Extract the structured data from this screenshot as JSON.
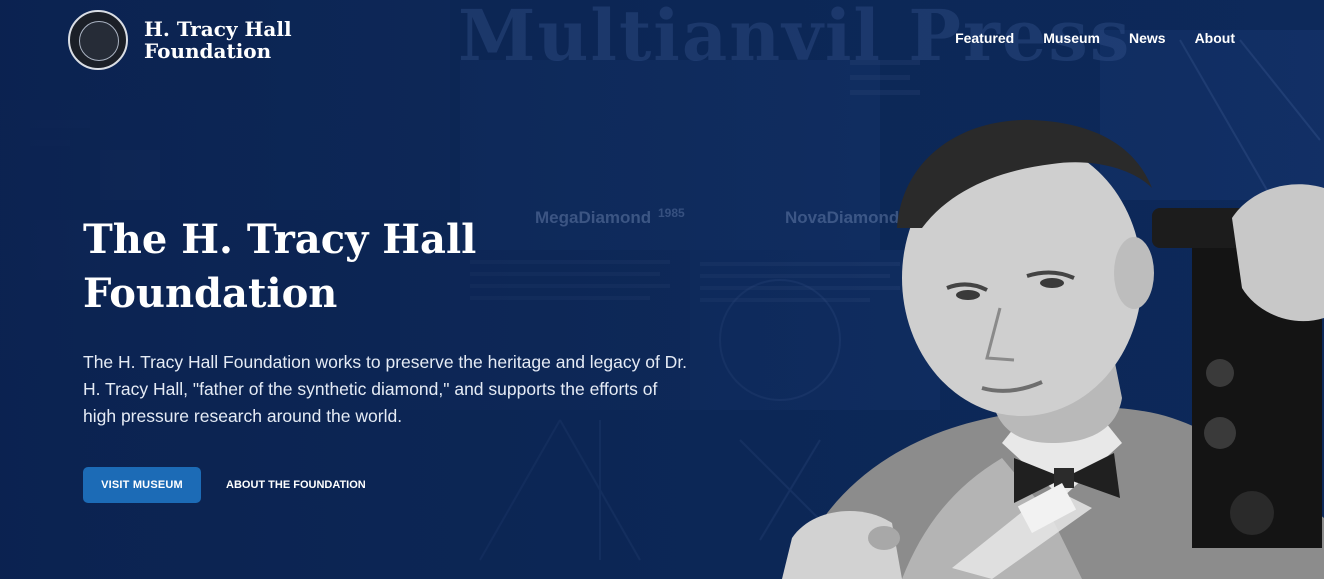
{
  "background": {
    "headline": "Multianvil Press",
    "labels": [
      "MegaDiamond",
      "NovaDiamond"
    ],
    "year": "1985"
  },
  "brand": {
    "name_line1": "H. Tracy Hall",
    "name_line2": "Foundation"
  },
  "nav": {
    "items": [
      "Featured",
      "Museum",
      "News",
      "About"
    ]
  },
  "hero": {
    "title_line1": "The H. Tracy Hall",
    "title_line2": "Foundation",
    "description": "The H. Tracy Hall Foundation works to preserve the heritage and legacy of Dr. H. Tracy Hall, \"father of the synthetic diamond,\" and supports the efforts of high pressure research around the world.",
    "primary_button": "VISIT MUSEUM",
    "secondary_button": "ABOUT THE FOUNDATION"
  },
  "colors": {
    "background": "#0c2552",
    "accent": "#1c6bb6"
  },
  "icons": {
    "seal": "foundation-seal-icon"
  }
}
